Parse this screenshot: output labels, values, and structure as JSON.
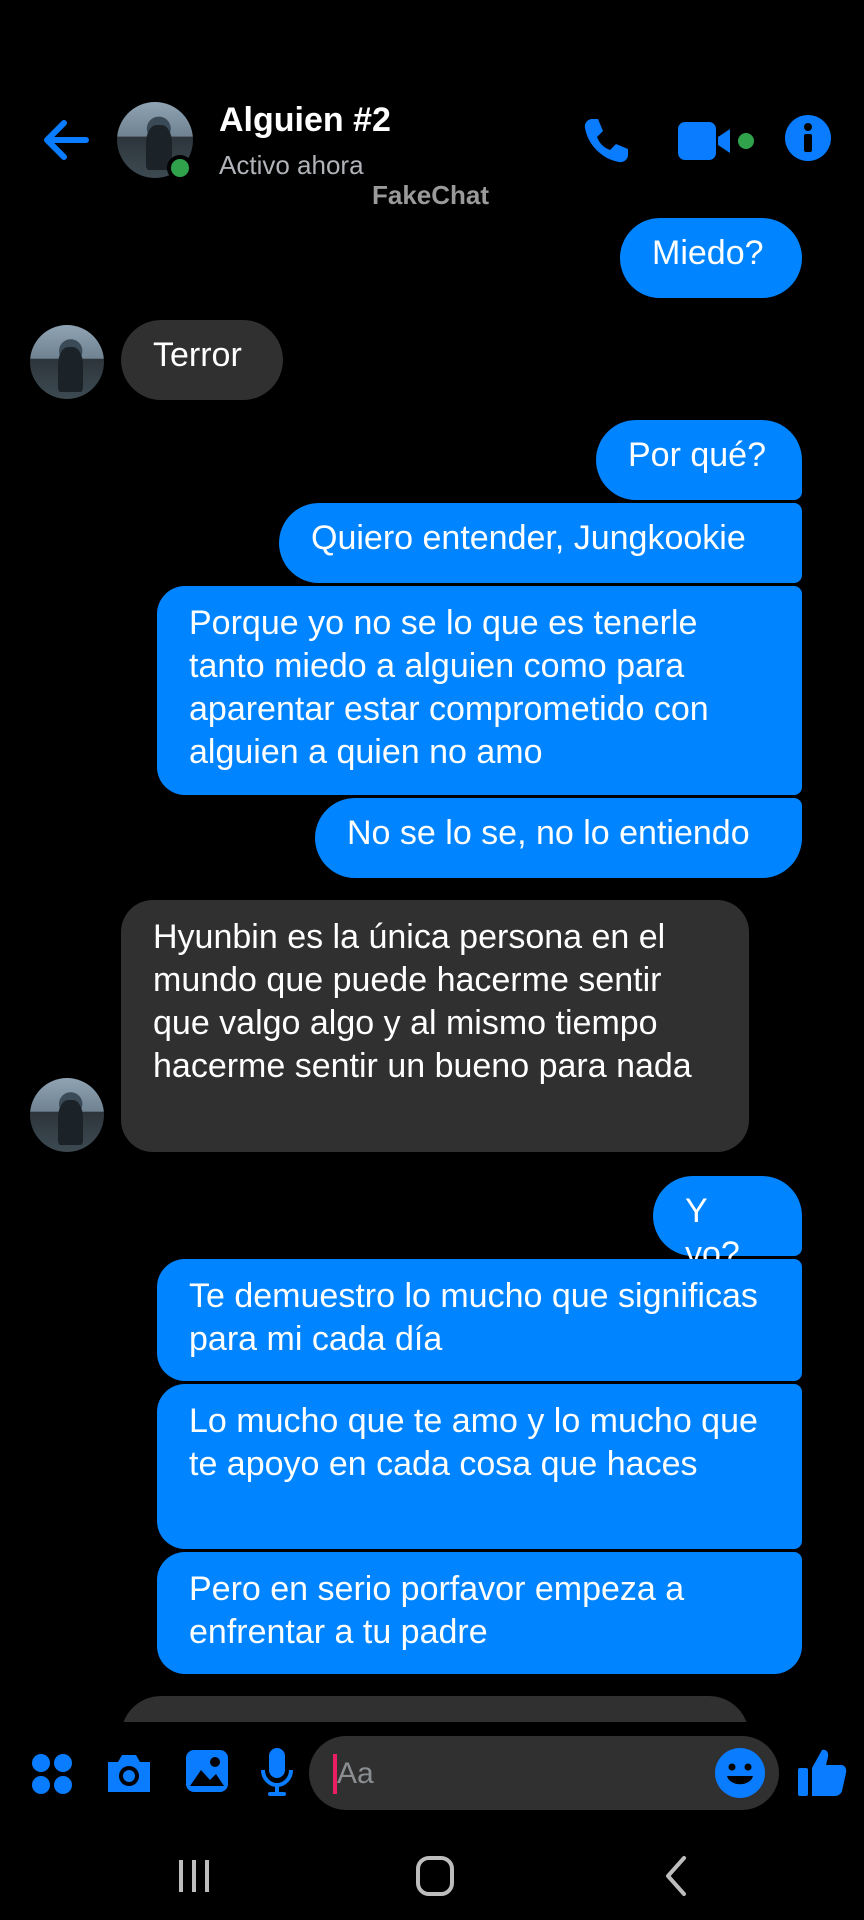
{
  "header": {
    "back_icon": "arrow-left-icon",
    "contact_name": "Alguien #2",
    "contact_status": "Activo ahora",
    "watermark": "FakeChat",
    "actions": [
      "phone-icon",
      "video-camera-icon",
      "info-icon"
    ]
  },
  "messages": [
    {
      "direction": "out",
      "text": "Miedo?"
    },
    {
      "direction": "in",
      "text": "Terror"
    },
    {
      "direction": "out",
      "text": "Por qué?"
    },
    {
      "direction": "out",
      "text": "Quiero entender, Jungkookie"
    },
    {
      "direction": "out",
      "text": "Porque yo no se lo que es tenerle tanto miedo a alguien como para aparentar estar comprometido con alguien a quien no amo"
    },
    {
      "direction": "out",
      "text": "No se lo se, no lo entiendo"
    },
    {
      "direction": "in",
      "text": "Hyunbin es la única persona en el mundo que puede hacerme sentir que valgo algo y al mismo tiempo hacerme sentir un bueno para nada"
    },
    {
      "direction": "out",
      "text": "Y yo?"
    },
    {
      "direction": "out",
      "text": "Te demuestro lo mucho que significas para mi cada día"
    },
    {
      "direction": "out",
      "text": "Lo mucho que te amo y lo mucho que te apoyo en cada cosa que haces"
    },
    {
      "direction": "out",
      "text": "Pero en serio porfavor empeza a enfrentar a tu padre"
    }
  ],
  "composer": {
    "placeholder": "Aa",
    "icons": [
      "apps-icon",
      "camera-icon",
      "image-icon",
      "microphone-icon",
      "emoji-icon",
      "thumbs-up-icon"
    ]
  },
  "system_nav": [
    "recent-apps-icon",
    "home-icon",
    "back-icon"
  ],
  "colors": {
    "accent": "#0084ff",
    "incoming_bubble": "#303030",
    "online": "#31a24c",
    "background": "#000000"
  }
}
